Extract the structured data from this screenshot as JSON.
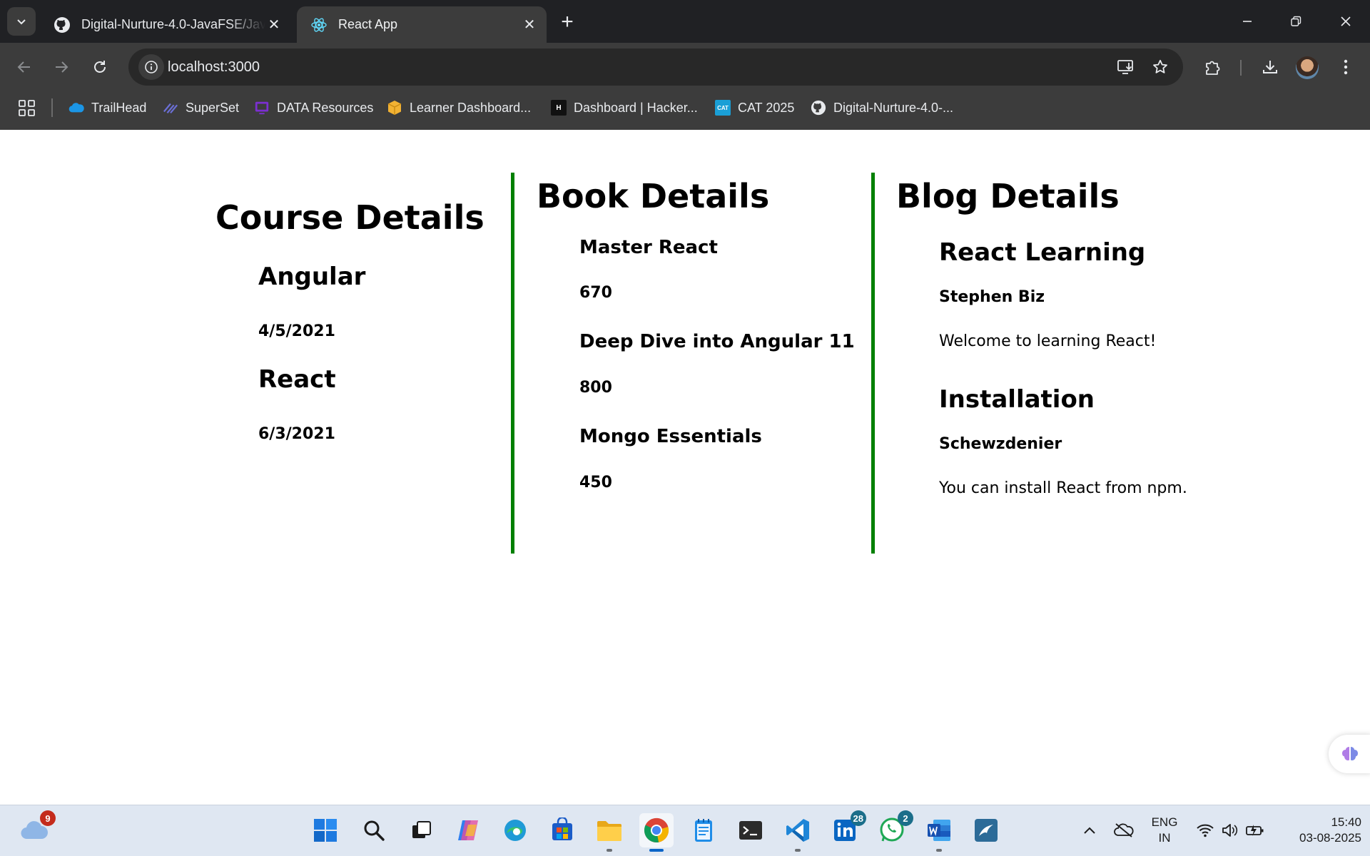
{
  "browser": {
    "tabs": [
      {
        "title": "Digital-Nurture-4.0-JavaFSE/Java",
        "favicon": "github-icon",
        "active": false
      },
      {
        "title": "React App",
        "favicon": "react-icon",
        "active": true
      }
    ],
    "address": "localhost:3000",
    "bookmarks": [
      {
        "label": "TrailHead",
        "icon": "salesforce-cloud-icon",
        "color": "#1b96e6"
      },
      {
        "label": "SuperSet",
        "icon": "superset-icon",
        "color": "#6b6fd6"
      },
      {
        "label": "DATA Resources",
        "icon": "data-resources-icon",
        "color": "#7b2fd0"
      },
      {
        "label": "Learner Dashboard...",
        "icon": "box-icon",
        "color": "#f2b233"
      },
      {
        "label": "Dashboard | Hacker...",
        "icon": "hackerrank-icon",
        "color": "#111111"
      },
      {
        "label": "CAT 2025",
        "icon": "cat-icon",
        "color": "#1a9fd6"
      },
      {
        "label": "Digital-Nurture-4.0-...",
        "icon": "github-icon",
        "color": "#e8eaed"
      }
    ],
    "bookmark_icon_text": {
      "hackerrank": "H",
      "cat": "CAT"
    }
  },
  "page": {
    "courses": {
      "heading": "Course Details",
      "items": [
        {
          "name": "Angular",
          "date": "4/5/2021"
        },
        {
          "name": "React",
          "date": "6/3/2021"
        }
      ]
    },
    "books": {
      "heading": "Book Details",
      "items": [
        {
          "name": "Master React",
          "price": "670"
        },
        {
          "name": "Deep Dive into Angular 11",
          "price": "800"
        },
        {
          "name": "Mongo Essentials",
          "price": "450"
        }
      ]
    },
    "blogs": {
      "heading": "Blog Details",
      "items": [
        {
          "title": "React Learning",
          "author": "Stephen Biz",
          "content": "Welcome to learning React!"
        },
        {
          "title": "Installation",
          "author": "Schewzdenier",
          "content": "You can install React from npm."
        }
      ]
    },
    "divider_color": "#008000"
  },
  "taskbar": {
    "weather_badge": "9",
    "linkedin_badge": "28",
    "whatsapp_badge": "2",
    "language": [
      "ENG",
      "IN"
    ],
    "time": "15:40",
    "date": "03-08-2025"
  }
}
